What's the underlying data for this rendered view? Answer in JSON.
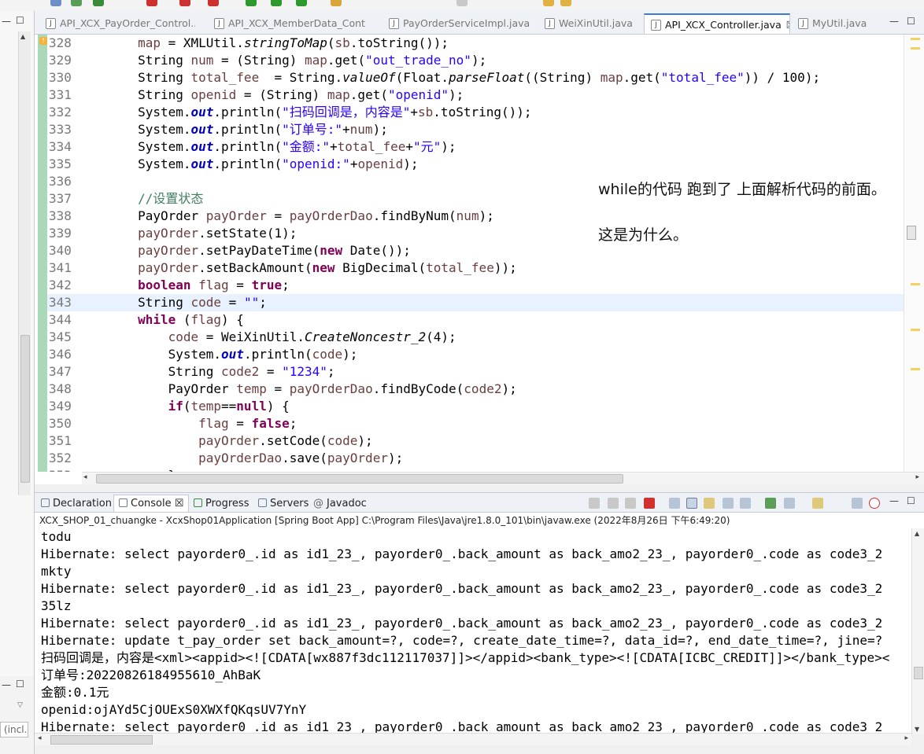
{
  "editor": {
    "tabs": [
      {
        "label": "API_XCX_PayOrder_Control...",
        "active": false
      },
      {
        "label": "API_XCX_MemberData_Cont...",
        "active": false
      },
      {
        "label": "PayOrderServiceImpl.java",
        "active": false
      },
      {
        "label": "WeiXinUtil.java",
        "active": false
      },
      {
        "label": "API_XCX_Controller.java",
        "active": true
      },
      {
        "label": "MyUtil.java",
        "active": false
      }
    ],
    "close_glyph": "☒",
    "lines": [
      {
        "n": "328",
        "code": "        map = XMLUtil.stringToMap(sb.toString());"
      },
      {
        "n": "329",
        "code": "        String num = (String) map.get(\"out_trade_no\");"
      },
      {
        "n": "330",
        "code": "        String total_fee  = String.valueOf(Float.parseFloat((String) map.get(\"total_fee\")) / 100);"
      },
      {
        "n": "331",
        "code": "        String openid = (String) map.get(\"openid\");"
      },
      {
        "n": "332",
        "code": "        System.out.println(\"扫码回调是，内容是\"+sb.toString());"
      },
      {
        "n": "333",
        "code": "        System.out.println(\"订单号:\"+num);"
      },
      {
        "n": "334",
        "code": "        System.out.println(\"金额:\"+total_fee+\"元\");"
      },
      {
        "n": "335",
        "code": "        System.out.println(\"openid:\"+openid);"
      },
      {
        "n": "336",
        "code": ""
      },
      {
        "n": "337",
        "code": "        //设置状态"
      },
      {
        "n": "338",
        "code": "        PayOrder payOrder = payOrderDao.findByNum(num);"
      },
      {
        "n": "339",
        "code": "        payOrder.setState(1);"
      },
      {
        "n": "340",
        "code": "        payOrder.setPayDateTime(new Date());"
      },
      {
        "n": "341",
        "code": "        payOrder.setBackAmount(new BigDecimal(total_fee));"
      },
      {
        "n": "342",
        "code": "        boolean flag = true;"
      },
      {
        "n": "343",
        "code": "        String code = \"\";"
      },
      {
        "n": "344",
        "code": "        while (flag) {"
      },
      {
        "n": "345",
        "code": "            code = WeiXinUtil.CreateNoncestr_2(4);"
      },
      {
        "n": "346",
        "code": "            System.out.println(code);"
      },
      {
        "n": "347",
        "code": "            String code2 = \"1234\";"
      },
      {
        "n": "348",
        "code": "            PayOrder temp = payOrderDao.findByCode(code2);"
      },
      {
        "n": "349",
        "code": "            if(temp==null) {"
      },
      {
        "n": "350",
        "code": "                flag = false;"
      },
      {
        "n": "351",
        "code": "                payOrder.setCode(code);"
      },
      {
        "n": "352",
        "code": "                payOrderDao.save(payOrder);"
      },
      {
        "n": "353",
        "code": "            }"
      }
    ],
    "highlight_line": "343"
  },
  "annotation": {
    "line1": "while的代码 跑到了 上面解析代码的前面。",
    "line2": "这是为什么。"
  },
  "console": {
    "tabs": [
      {
        "label": "Declaration",
        "active": false
      },
      {
        "label": "Console ☒",
        "active": true
      },
      {
        "label": "Progress",
        "active": false
      },
      {
        "label": "Servers",
        "active": false
      },
      {
        "label": "Javadoc",
        "active": false
      }
    ],
    "header": "XCX_SHOP_01_chuangke - XcxShop01Application [Spring Boot App] C:\\Program Files\\Java\\jre1.8.0_101\\bin\\javaw.exe (2022年8月26日 下午6:49:20)",
    "lines": [
      "todu",
      "Hibernate: select payorder0_.id as id1_23_, payorder0_.back_amount as back_amo2_23_, payorder0_.code as code3_2",
      "mkty",
      "Hibernate: select payorder0_.id as id1_23_, payorder0_.back_amount as back_amo2_23_, payorder0_.code as code3_2",
      "35lz",
      "Hibernate: select payorder0_.id as id1_23_, payorder0_.back_amount as back_amo2_23_, payorder0_.code as code3_2",
      "Hibernate: update t_pay_order set back_amount=?, code=?, create_date_time=?, data_id=?, end_date_time=?, jine=?",
      "扫码回调是，内容是<xml><appid><![CDATA[wx887f3dc112117037]]></appid><bank_type><![CDATA[ICBC_CREDIT]]></bank_type><",
      "订单号:20220826184955610_AhBaK",
      "金额:0.1元",
      "openid:ojAYd5CjOUExS0XWXfQKqsUV7YnY",
      "Hibernate: select payorder0 .id as id1 23 , payorder0 .back amount as back amo2 23 , payorder0 .code as code3 2"
    ]
  },
  "left_panel": {
    "filter_placeholder": "(incl."
  },
  "colors": {
    "keyword": "#7f0055",
    "string": "#2a00ff",
    "field": "#0000c0",
    "variable": "#6a3e3e",
    "comment": "#3f7f5f",
    "highlight": "#e8f2fe",
    "change_ruler": "#a9d9b8"
  }
}
